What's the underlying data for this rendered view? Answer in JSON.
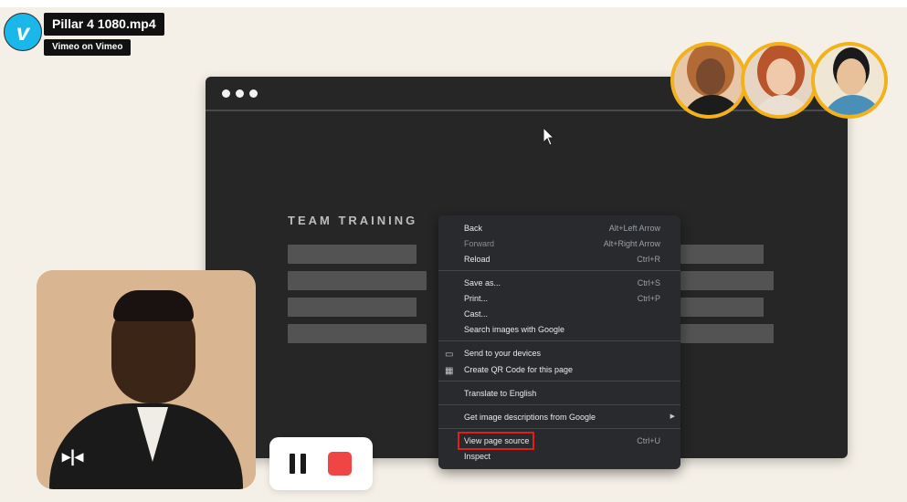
{
  "video": {
    "title": "Pillar 4 1080.mp4",
    "subtitle": "Vimeo on Vimeo",
    "logo_letter": "v",
    "logo_icon": "vimeo-logo-icon"
  },
  "browser": {
    "heading": "TEAM TRAINING"
  },
  "context_menu": {
    "items": [
      {
        "label": "Back",
        "shortcut": "Alt+Left Arrow"
      },
      {
        "label": "Forward",
        "shortcut": "Alt+Right Arrow"
      },
      {
        "label": "Reload",
        "shortcut": "Ctrl+R"
      },
      {
        "label": "Save as...",
        "shortcut": "Ctrl+S"
      },
      {
        "label": "Print...",
        "shortcut": "Ctrl+P"
      },
      {
        "label": "Cast...",
        "shortcut": ""
      },
      {
        "label": "Search images with Google",
        "shortcut": ""
      },
      {
        "label": "Send to your devices",
        "shortcut": "",
        "icon": "devices-icon"
      },
      {
        "label": "Create QR Code for this page",
        "shortcut": "",
        "icon": "qr-code-icon"
      },
      {
        "label": "Translate to English",
        "shortcut": ""
      },
      {
        "label": "Get image descriptions from Google",
        "shortcut": "",
        "has_submenu": true
      },
      {
        "label": "View page source",
        "shortcut": "Ctrl+U",
        "highlighted": true
      },
      {
        "label": "Inspect",
        "shortcut": ""
      }
    ]
  },
  "controls": {
    "pause_icon": "pause-icon",
    "stop_icon": "stop-icon",
    "flip_icon": "flip-camera-icon"
  },
  "colors": {
    "accent_ring": "#f2b21b",
    "stop_red": "#f04545",
    "highlight_red": "#e11d1d",
    "vimeo_blue": "#1ab7ea"
  }
}
